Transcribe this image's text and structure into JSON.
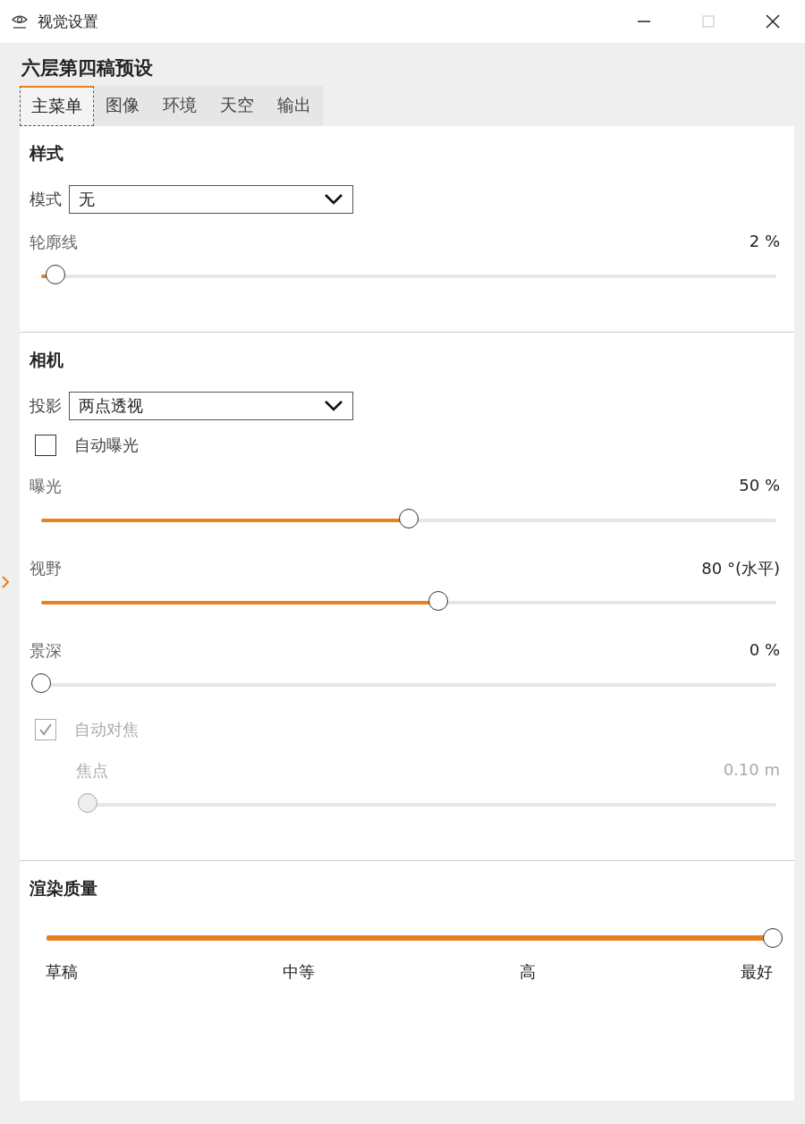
{
  "window": {
    "title": "视觉设置"
  },
  "preset_title": "六层第四稿预设",
  "tabs": [
    {
      "label": "主菜单",
      "selected": true
    },
    {
      "label": "图像",
      "selected": false
    },
    {
      "label": "环境",
      "selected": false
    },
    {
      "label": "天空",
      "selected": false
    },
    {
      "label": "输出",
      "selected": false
    }
  ],
  "sections": [
    {
      "title": "样式",
      "items": [
        {
          "kind": "dropdown",
          "label": "模式",
          "value": "无"
        },
        {
          "kind": "slider",
          "label": "轮廓线",
          "reading": "2 %",
          "level": 0.02,
          "disabled": false
        }
      ]
    },
    {
      "title": "相机",
      "items": [
        {
          "kind": "dropdown",
          "label": "投影",
          "value": "两点透视"
        },
        {
          "kind": "checkbox",
          "label": "自动曝光",
          "checked": false,
          "disabled": false
        },
        {
          "kind": "slider",
          "label": "曝光",
          "reading": "50 %",
          "level": 0.5,
          "disabled": false
        },
        {
          "kind": "slider",
          "label": "视野",
          "reading": "80 °(水平)",
          "level": 0.54,
          "disabled": false
        },
        {
          "kind": "slider",
          "label": "景深",
          "reading": "0 %",
          "level": 0,
          "disabled": false
        },
        {
          "kind": "checkbox",
          "label": "自动对焦",
          "checked": true,
          "disabled": true,
          "children": [
            {
              "kind": "slider",
              "label": "焦点",
              "reading": "0.10 m",
              "level": 0,
              "disabled": true
            }
          ]
        }
      ]
    },
    {
      "title": "渲染质量",
      "items": [
        {
          "kind": "steps",
          "level": 1,
          "steps": [
            "草稿",
            "中等",
            "高",
            "最好"
          ]
        }
      ]
    }
  ]
}
